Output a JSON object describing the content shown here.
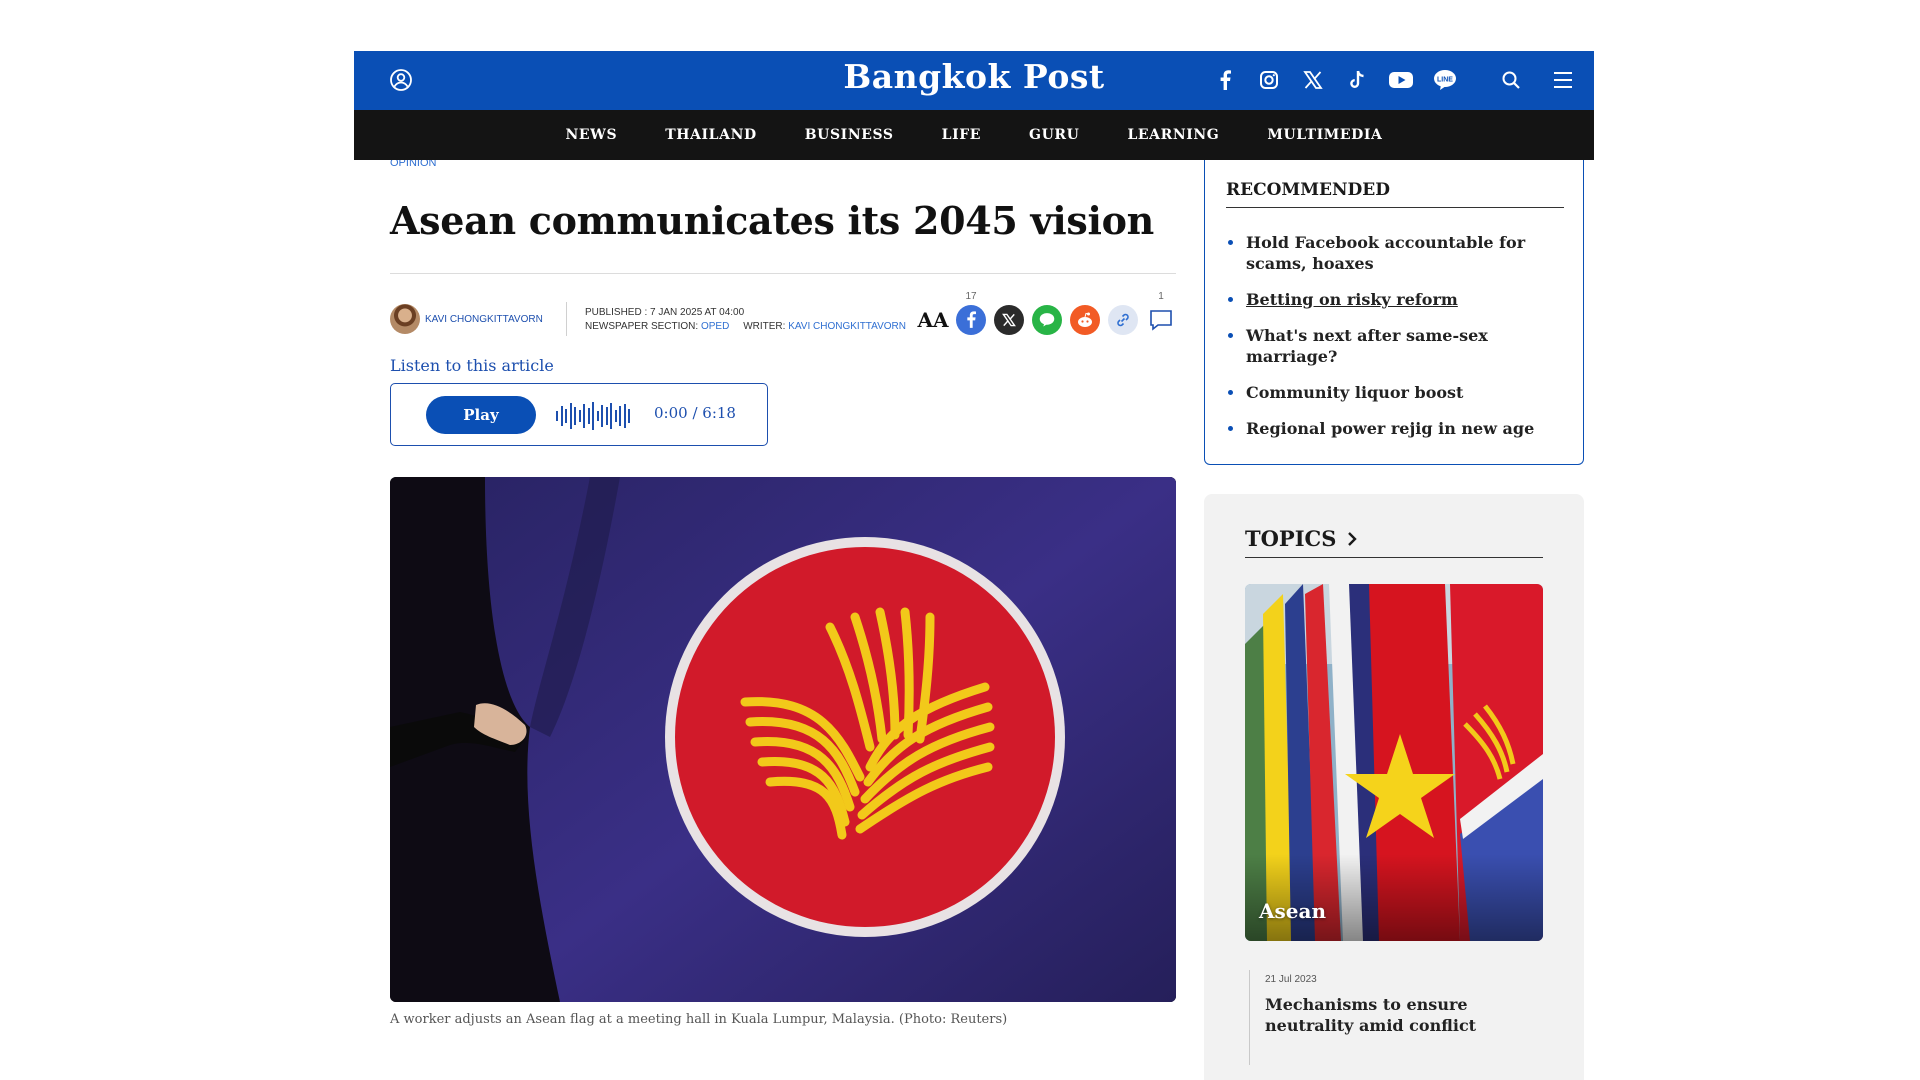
{
  "header": {
    "logo": "Bangkok Post",
    "social_icons": [
      "facebook-icon",
      "instagram-icon",
      "x-icon",
      "tiktok-icon",
      "youtube-icon",
      "line-icon"
    ],
    "brand_color": "#0a4fb5"
  },
  "nav": {
    "items": [
      "NEWS",
      "THAILAND",
      "BUSINESS",
      "LIFE",
      "GURU",
      "LEARNING",
      "MULTIMEDIA"
    ]
  },
  "article": {
    "section": "OPINION",
    "headline": "Asean communicates its 2045 vision",
    "author": "KAVI CHONGKITTAVORN",
    "published_label": "PUBLISHED : 7 JAN 2025 AT 04:00",
    "newspaper_section_label": "NEWSPAPER SECTION:",
    "newspaper_section": "OPED",
    "writer_label": "WRITER:",
    "writer": "KAVI CHONGKITTAVORN",
    "share": {
      "font_size_label": "AA",
      "facebook_count": "17",
      "comment_count": "1"
    },
    "listen_label": "Listen to this article",
    "player": {
      "play_label": "Play",
      "time": "0:00 / 6:18"
    },
    "caption": "A worker adjusts an Asean flag at a meeting hall in Kuala Lumpur, Malaysia. (Photo: Reuters)"
  },
  "recommended": {
    "title": "RECOMMENDED",
    "items": [
      "Hold Facebook accountable for scams, hoaxes",
      "Betting on risky reform",
      "What's next after same-sex marriage?",
      "Community liquor boost",
      "Regional power rejig in new age"
    ]
  },
  "topics": {
    "title": "TOPICS",
    "tag": "Asean",
    "story": {
      "date": "21 Jul 2023",
      "title": "Mechanisms to ensure neutrality amid conflict"
    }
  }
}
